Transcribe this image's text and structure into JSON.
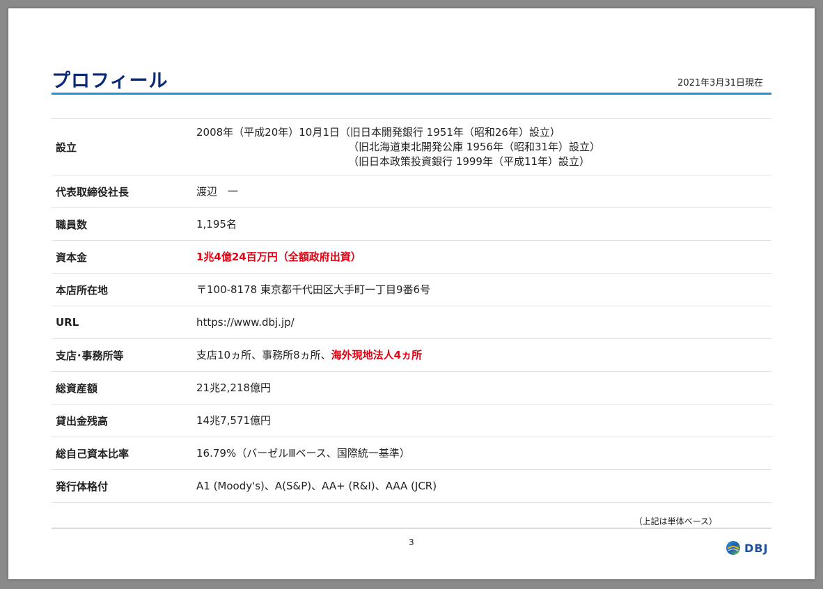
{
  "header": {
    "title": "プロフィール",
    "date": "2021年3月31日現在"
  },
  "rows": [
    {
      "label": "設立",
      "lines": [
        "2008年（平成20年）10月1日（旧日本開発銀行 1951年（昭和26年）設立）",
        "（旧北海道東北開発公庫 1956年（昭和31年）設立）",
        "（旧日本政策投資銀行 1999年（平成11年）設立）"
      ]
    },
    {
      "label": "代表取締役社長",
      "value": "渡辺　一"
    },
    {
      "label": "職員数",
      "value": "1,195名"
    },
    {
      "label": "資本金",
      "value": "1兆4億24百万円（全額政府出資）"
    },
    {
      "label": "本店所在地",
      "value": "〒100-8178 東京都千代田区大手町一丁目9番6号"
    },
    {
      "label": "URL",
      "value": "https://www.dbj.jp/"
    },
    {
      "label": "支店･事務所等",
      "value_part1": "支店10ヵ所、事務所8ヵ所、",
      "value_part2": "海外現地法人4ヵ所"
    },
    {
      "label": "総資産額",
      "value": "21兆2,218億円"
    },
    {
      "label": "貸出金残高",
      "value": "14兆7,571億円"
    },
    {
      "label": "総自己資本比率",
      "value": "16.79%（バーゼルⅢベース、国際統一基準）"
    },
    {
      "label": "発行体格付",
      "value": "A1 (Moody's)、A(S&P)、AA+ (R&I)、AAA (JCR)"
    }
  ],
  "footer": {
    "note": "（上記は単体ベース）",
    "page_number": "3",
    "logo_text": "DBJ"
  },
  "colors": {
    "title": "#0a2a78",
    "accent_rule": "#1f8fd6",
    "highlight_red": "#e60012"
  }
}
